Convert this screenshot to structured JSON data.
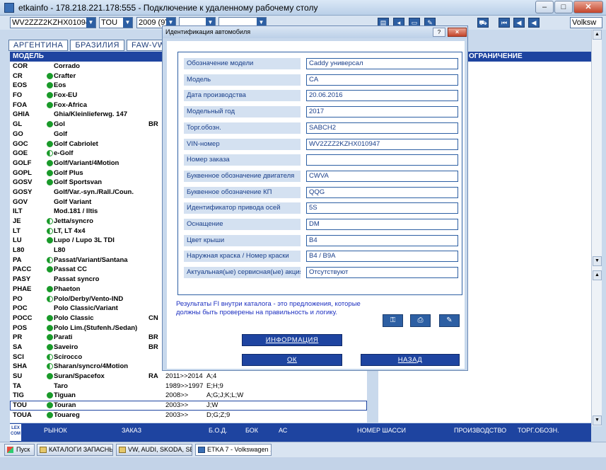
{
  "window": {
    "title": "etkainfo - 178.218.221.178:555 - Подключение к удаленному рабочему столу"
  },
  "toolbar": {
    "vin_combo": "WV2ZZZ2KZHX010947",
    "market_combo": "TOU",
    "year_combo": "2009 (9)",
    "brand_combo": "Volksw"
  },
  "tabs": [
    "АРГЕНТИНА",
    "БРАЗИЛИЯ",
    "FAW-VW"
  ],
  "list_header": "МОДЕЛЬ",
  "right_header": "ОГРАНИЧЕНИЕ",
  "models": [
    {
      "code": "COR",
      "name": "Corrado",
      "dot": "none",
      "region": "",
      "years": "",
      "engines": ""
    },
    {
      "code": "CR",
      "name": "Crafter",
      "dot": "full",
      "region": "",
      "years": "",
      "engines": ""
    },
    {
      "code": "EOS",
      "name": "Eos",
      "dot": "full",
      "region": "",
      "years": "",
      "engines": ""
    },
    {
      "code": "FO",
      "name": "Fox-EU",
      "dot": "full",
      "region": "",
      "years": "",
      "engines": ""
    },
    {
      "code": "FOA",
      "name": "Fox-Africa",
      "dot": "full",
      "region": "",
      "years": "",
      "engines": ""
    },
    {
      "code": "GHIA",
      "name": "Ghia/Kleinlieferwg. 147",
      "dot": "none",
      "region": "",
      "years": "",
      "engines": ""
    },
    {
      "code": "GL",
      "name": "Gol",
      "dot": "full",
      "region": "BR",
      "years": "",
      "engines": ""
    },
    {
      "code": "GO",
      "name": "Golf",
      "dot": "none",
      "region": "",
      "years": "",
      "engines": ""
    },
    {
      "code": "GOC",
      "name": "Golf Cabriolet",
      "dot": "full",
      "region": "",
      "years": "",
      "engines": ""
    },
    {
      "code": "GOE",
      "name": "e-Golf",
      "dot": "half",
      "region": "",
      "years": "",
      "engines": ""
    },
    {
      "code": "GOLF",
      "name": "Golf/Variant/4Motion",
      "dot": "full",
      "region": "",
      "years": "",
      "engines": ""
    },
    {
      "code": "GOPL",
      "name": "Golf Plus",
      "dot": "full",
      "region": "",
      "years": "",
      "engines": ""
    },
    {
      "code": "GOSV",
      "name": "Golf Sportsvan",
      "dot": "full",
      "region": "",
      "years": "",
      "engines": ""
    },
    {
      "code": "GOSY",
      "name": "Golf/Var.-syn./Rall./Coun.",
      "dot": "none",
      "region": "",
      "years": "",
      "engines": ""
    },
    {
      "code": "GOV",
      "name": "Golf Variant",
      "dot": "none",
      "region": "",
      "years": "",
      "engines": ""
    },
    {
      "code": "ILT",
      "name": "Mod.181 / Iltis",
      "dot": "none",
      "region": "",
      "years": "",
      "engines": ""
    },
    {
      "code": "JE",
      "name": "Jetta/syncro",
      "dot": "half",
      "region": "",
      "years": "",
      "engines": ""
    },
    {
      "code": "LT",
      "name": "LT, LT 4x4",
      "dot": "half",
      "region": "",
      "years": "",
      "engines": ""
    },
    {
      "code": "LU",
      "name": "Lupo / Lupo 3L TDI",
      "dot": "full",
      "region": "",
      "years": "",
      "engines": ""
    },
    {
      "code": "L80",
      "name": "L80",
      "dot": "none",
      "region": "",
      "years": "",
      "engines": ""
    },
    {
      "code": "PA",
      "name": "Passat/Variant/Santana",
      "dot": "half",
      "region": "",
      "years": "",
      "engines": ""
    },
    {
      "code": "PACC",
      "name": "Passat CC",
      "dot": "full",
      "region": "",
      "years": "",
      "engines": ""
    },
    {
      "code": "PASY",
      "name": "Passat syncro",
      "dot": "none",
      "region": "",
      "years": "",
      "engines": ""
    },
    {
      "code": "PHAE",
      "name": "Phaeton",
      "dot": "full",
      "region": "",
      "years": "",
      "engines": ""
    },
    {
      "code": "PO",
      "name": "Polo/Derby/Vento-IND",
      "dot": "half",
      "region": "",
      "years": "",
      "engines": ""
    },
    {
      "code": "POC",
      "name": "Polo Classic/Variant",
      "dot": "none",
      "region": "",
      "years": "",
      "engines": ""
    },
    {
      "code": "POCC",
      "name": "Polo Classic",
      "dot": "full",
      "region": "CN",
      "years": "",
      "engines": ""
    },
    {
      "code": "POS",
      "name": "Polo Lim.(Stufenh./Sedan)",
      "dot": "full",
      "region": "",
      "years": "",
      "engines": ""
    },
    {
      "code": "PR",
      "name": "Parati",
      "dot": "full",
      "region": "BR",
      "years": "",
      "engines": ""
    },
    {
      "code": "SA",
      "name": "Saveiro",
      "dot": "full",
      "region": "BR",
      "years": "",
      "engines": ""
    },
    {
      "code": "SCI",
      "name": "Scirocco",
      "dot": "half",
      "region": "",
      "years": "",
      "engines": ""
    },
    {
      "code": "SHA",
      "name": "Sharan/syncro/4Motion",
      "dot": "half",
      "region": "",
      "years": "",
      "engines": ""
    },
    {
      "code": "SU",
      "name": "Suran/Spacefox",
      "dot": "full",
      "region": "RA",
      "years": "2011>>2014",
      "engines": "A;4"
    },
    {
      "code": "TA",
      "name": "Taro",
      "dot": "none",
      "region": "",
      "years": "1989>>1997",
      "engines": "E;H;9"
    },
    {
      "code": "TIG",
      "name": "Tiguan",
      "dot": "full",
      "region": "",
      "years": "2008>>",
      "engines": "A;G;J;K;L;W"
    },
    {
      "code": "TOU",
      "name": "Touran",
      "dot": "full",
      "region": "",
      "years": "2003>>",
      "engines": "J;W",
      "selected": true
    },
    {
      "code": "TOUA",
      "name": "Touareg",
      "dot": "full",
      "region": "",
      "years": "2003>>",
      "engines": "D;G;Z;9"
    }
  ],
  "statusbar": {
    "lex": "LEX COM",
    "cols": [
      "РЫНОК",
      "ЗАКАЗ",
      "Б.О.Д.",
      "БОК",
      "АС",
      "НОМЕР ШАССИ",
      "ПРОИЗВОДСТВО",
      "ТОРГ.ОБОЗН."
    ]
  },
  "taskbar": {
    "start": "Пуск",
    "items": [
      "КАТАЛОГИ ЗАПАСНЫХ ...",
      "VW, AUDI, SKODA, SEAT",
      "ETKA 7 - Volkswagen ..."
    ]
  },
  "dialog": {
    "title": "Идентификация автомобиля",
    "help": "?",
    "close": "×",
    "fields": [
      {
        "label": "Обозначение модели",
        "value": "Caddy универсал"
      },
      {
        "label": "Модель",
        "value": "CA"
      },
      {
        "label": "Дата производства",
        "value": "20.06.2016"
      },
      {
        "label": "Модельный год",
        "value": "2017"
      },
      {
        "label": "Торг.обозн.",
        "value": "SABCH2"
      },
      {
        "label": "VIN-номер",
        "value": "WV2ZZZ2KZHX010947"
      },
      {
        "label": "Номер заказа",
        "value": ""
      },
      {
        "label": "Буквенное обозначение двигателя",
        "value": "CWVA"
      },
      {
        "label": "Буквенное обозначение КП",
        "value": "QQG"
      },
      {
        "label": "Идентификатор привода осей",
        "value": "5S"
      },
      {
        "label": "Оснащение",
        "value": "DM"
      },
      {
        "label": "Цвет крыши",
        "value": "B4"
      },
      {
        "label": "Наружная краска / Номер краски",
        "value": "B4 / B9A"
      },
      {
        "label": "Актуальная(ые) сервисная(ые) акция(и)",
        "value": "Отсутствуют"
      }
    ],
    "note_line1": "Результаты  FI внутри каталога - это предложения, которые",
    "note_line2": "должны быть проверены на правильность и логику.",
    "info_button": "ИНФОРМАЦИЯ",
    "ok_button": "ОК",
    "back_button": "НАЗАД"
  }
}
